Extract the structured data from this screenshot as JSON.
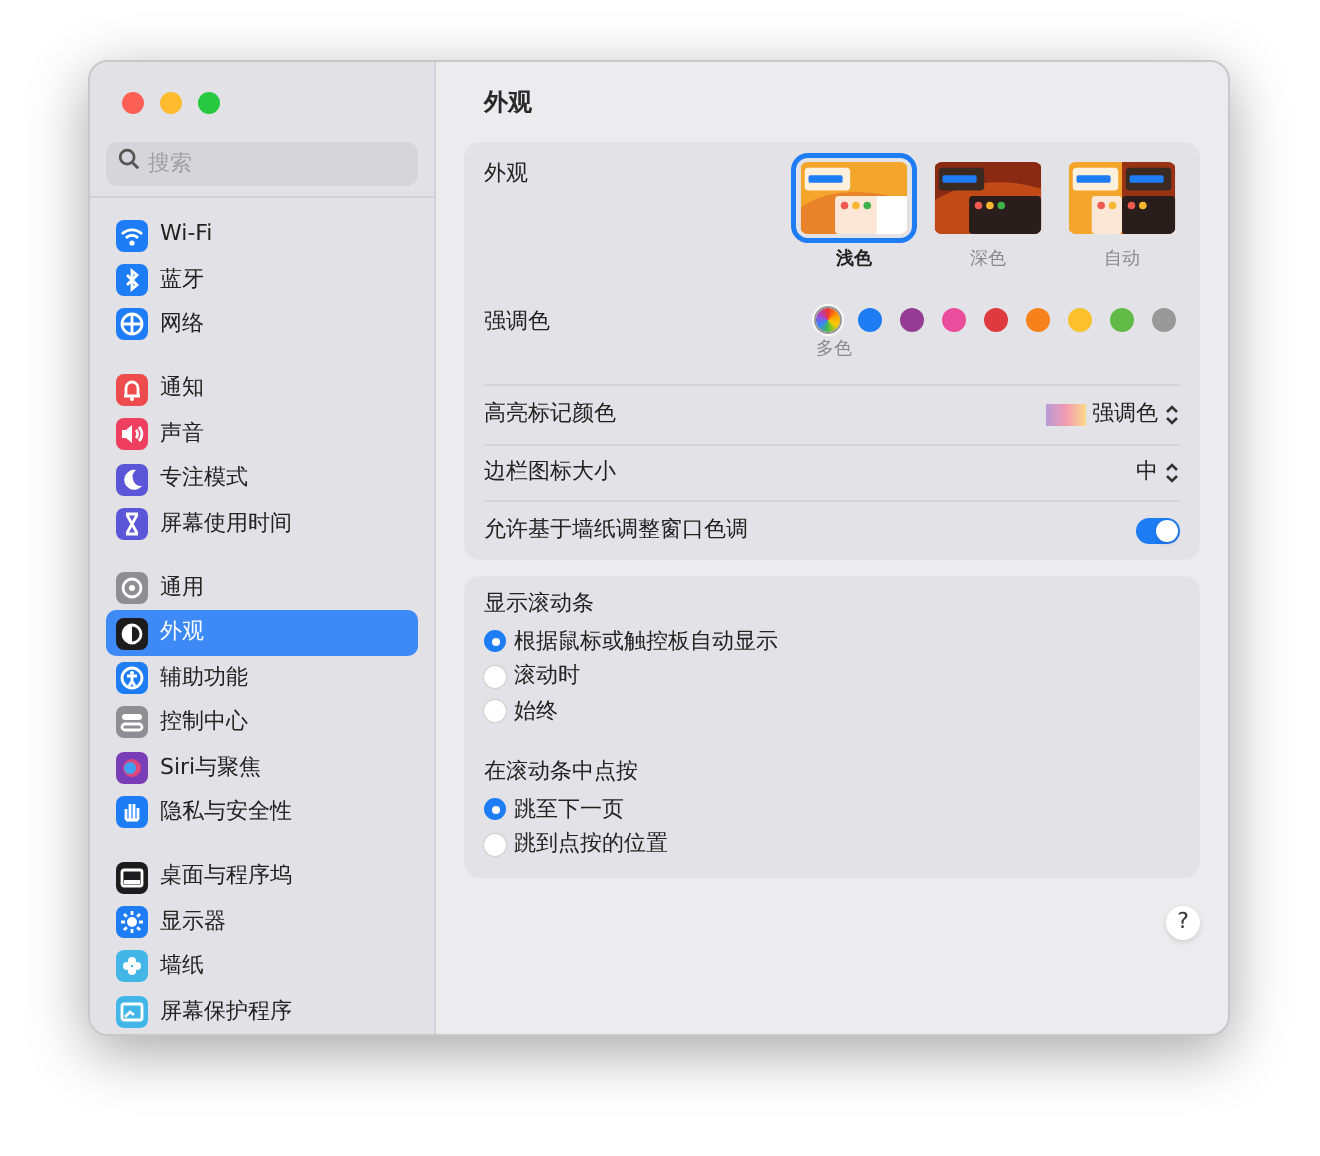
{
  "window": {
    "title": "外观"
  },
  "sidebar": {
    "search": {
      "placeholder": "搜索"
    },
    "groups": [
      [
        {
          "label": "Wi-Fi",
          "kind": "wifi",
          "selected": false
        },
        {
          "label": "蓝牙",
          "kind": "bluetooth",
          "selected": false
        },
        {
          "label": "网络",
          "kind": "network",
          "selected": false
        }
      ],
      [
        {
          "label": "通知",
          "kind": "notifications",
          "selected": false
        },
        {
          "label": "声音",
          "kind": "sound",
          "selected": false
        },
        {
          "label": "专注模式",
          "kind": "focus",
          "selected": false
        },
        {
          "label": "屏幕使用时间",
          "kind": "screentime",
          "selected": false
        }
      ],
      [
        {
          "label": "通用",
          "kind": "general",
          "selected": false
        },
        {
          "label": "外观",
          "kind": "appearance",
          "selected": true
        },
        {
          "label": "辅助功能",
          "kind": "accessibility",
          "selected": false
        },
        {
          "label": "控制中心",
          "kind": "controlcenter",
          "selected": false
        },
        {
          "label": "Siri与聚焦",
          "kind": "siri",
          "selected": false
        },
        {
          "label": "隐私与安全性",
          "kind": "privacy",
          "selected": false
        }
      ],
      [
        {
          "label": "桌面与程序坞",
          "kind": "desktop",
          "selected": false
        },
        {
          "label": "显示器",
          "kind": "displays",
          "selected": false
        },
        {
          "label": "墙纸",
          "kind": "wallpaper",
          "selected": false
        },
        {
          "label": "屏幕保护程序",
          "kind": "screensaver",
          "selected": false
        }
      ]
    ]
  },
  "appearance": {
    "label": "外观",
    "options": [
      {
        "label": "浅色",
        "kind": "light",
        "selected": true
      },
      {
        "label": "深色",
        "kind": "dark",
        "selected": false
      },
      {
        "label": "自动",
        "kind": "auto",
        "selected": false
      }
    ]
  },
  "accent": {
    "label": "强调色",
    "selected_label": "多色",
    "colors": [
      {
        "kind": "multicolor",
        "selected": true
      },
      {
        "color": "#1e7cf5",
        "selected": false
      },
      {
        "color": "#953d96",
        "selected": false
      },
      {
        "color": "#e94d9c",
        "selected": false
      },
      {
        "color": "#df3a3f",
        "selected": false
      },
      {
        "color": "#f7821b",
        "selected": false
      },
      {
        "color": "#fbc02d",
        "selected": false
      },
      {
        "color": "#62ba46",
        "selected": false
      },
      {
        "color": "#989898",
        "selected": false
      }
    ]
  },
  "highlight": {
    "label": "高亮标记颜色",
    "value": "强调色"
  },
  "sidebar_icon_size": {
    "label": "边栏图标大小",
    "value": "中"
  },
  "wallpaper_tinting": {
    "label": "允许基于墙纸调整窗口色调",
    "on": true
  },
  "radio_groups": [
    {
      "label": "显示滚动条",
      "options": [
        {
          "label": "根据鼠标或触控板自动显示",
          "selected": true
        },
        {
          "label": "滚动时",
          "selected": false
        },
        {
          "label": "始终",
          "selected": false
        }
      ]
    },
    {
      "label": "在滚动条中点按",
      "options": [
        {
          "label": "跳至下一页",
          "selected": true
        },
        {
          "label": "跳到点按的位置",
          "selected": false
        }
      ]
    }
  ],
  "help_button": "?"
}
